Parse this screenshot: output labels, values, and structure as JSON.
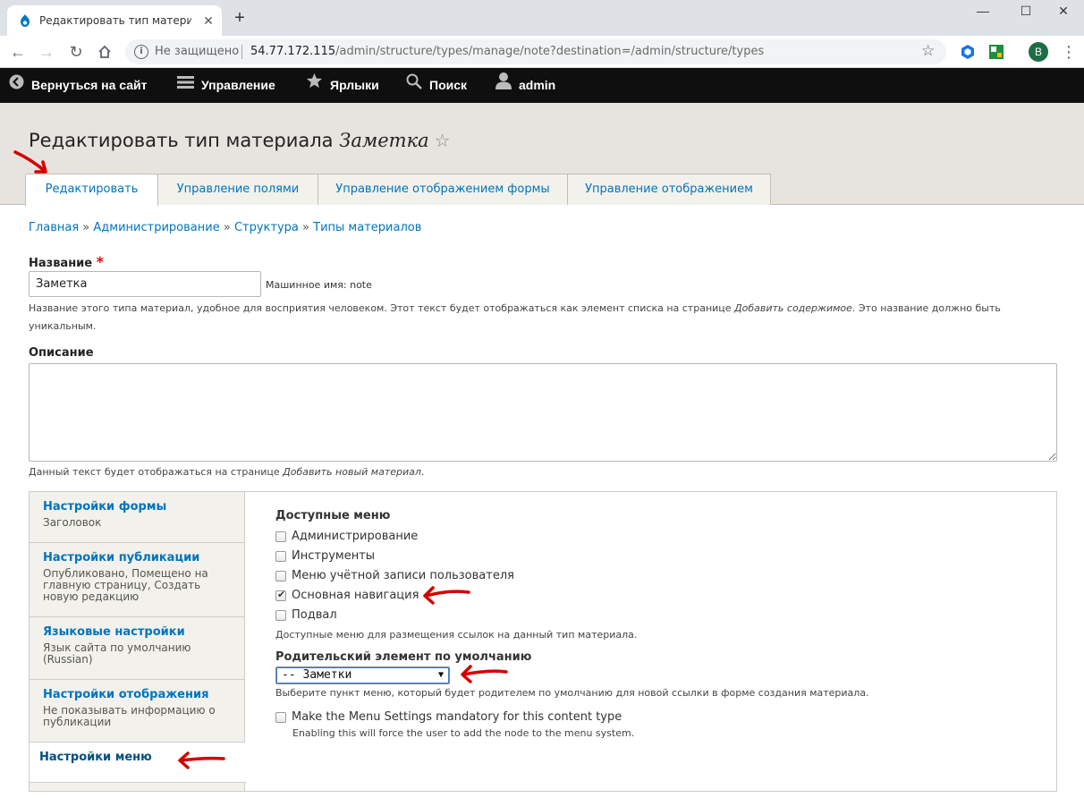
{
  "browser": {
    "tab_title": "Редактировать тип материала З",
    "insecure_label": "Не защищено",
    "url_host": "54.77.172.115",
    "url_path": "/admin/structure/types/manage/note?destination=/admin/structure/types",
    "profile_initial": "B"
  },
  "admin_toolbar": {
    "back_label": "Вернуться на сайт",
    "manage_label": "Управление",
    "shortcuts_label": "Ярлыки",
    "search_label": "Поиск",
    "user_label": "admin"
  },
  "header": {
    "title_prefix": "Редактировать тип материала",
    "title_name": "Заметка",
    "tabs": [
      {
        "label": "Редактировать",
        "active": true
      },
      {
        "label": "Управление полями",
        "active": false
      },
      {
        "label": "Управление отображением формы",
        "active": false
      },
      {
        "label": "Управление отображением",
        "active": false
      }
    ]
  },
  "breadcrumb": {
    "items": [
      "Главная",
      "Администрирование",
      "Структура",
      "Типы материалов"
    ],
    "separator": "»"
  },
  "form": {
    "name_label": "Название",
    "name_required_mark": "*",
    "name_value": "Заметка",
    "machine_name": "Машинное имя: note",
    "name_desc_pre": "Название этого типа материал, удобное для восприятия человеком. Этот текст будет отображаться как элемент списка на странице ",
    "name_desc_em": "Добавить содержимое",
    "name_desc_post": ". Это название должно быть уникальным.",
    "description_label": "Описание",
    "description_value": "",
    "description_help_pre": "Данный текст будет отображаться на странице ",
    "description_help_em": "Добавить новый материал",
    "description_help_post": "."
  },
  "vertical_tabs": {
    "items": [
      {
        "title": "Настройки формы",
        "summary": "Заголовок"
      },
      {
        "title": "Настройки публикации",
        "summary": "Опубликовано, Помещено на главную страницу, Создать новую редакцию"
      },
      {
        "title": "Языковые настройки",
        "summary": "Язык сайта по умолчанию (Russian)"
      },
      {
        "title": "Настройки отображения",
        "summary": "Не показывать информацию о публикации"
      },
      {
        "title": "Настройки меню",
        "summary": ""
      }
    ]
  },
  "menu_settings": {
    "available_menus_label": "Доступные меню",
    "menus": [
      {
        "label": "Администрирование",
        "checked": false
      },
      {
        "label": "Инструменты",
        "checked": false
      },
      {
        "label": "Меню учётной записи пользователя",
        "checked": false
      },
      {
        "label": "Основная навигация",
        "checked": true
      },
      {
        "label": "Подвал",
        "checked": false
      }
    ],
    "available_menus_desc": "Доступные меню для размещения ссылок на данный тип материала.",
    "parent_label": "Родительский элемент по умолчанию",
    "parent_value": "-- Заметки",
    "parent_desc": "Выберите пункт меню, который будет родителем по умолчанию для новой ссылки в форме создания материала.",
    "mandatory_label": "Make the Menu Settings mandatory for this content type",
    "mandatory_checked": false,
    "mandatory_desc": "Enabling this will force the user to add the node to the menu system."
  },
  "colors": {
    "link": "#0074bd",
    "admin_bar": "#0f0f0f",
    "header_bg": "#e7e4df",
    "arrow": "#d40000"
  }
}
